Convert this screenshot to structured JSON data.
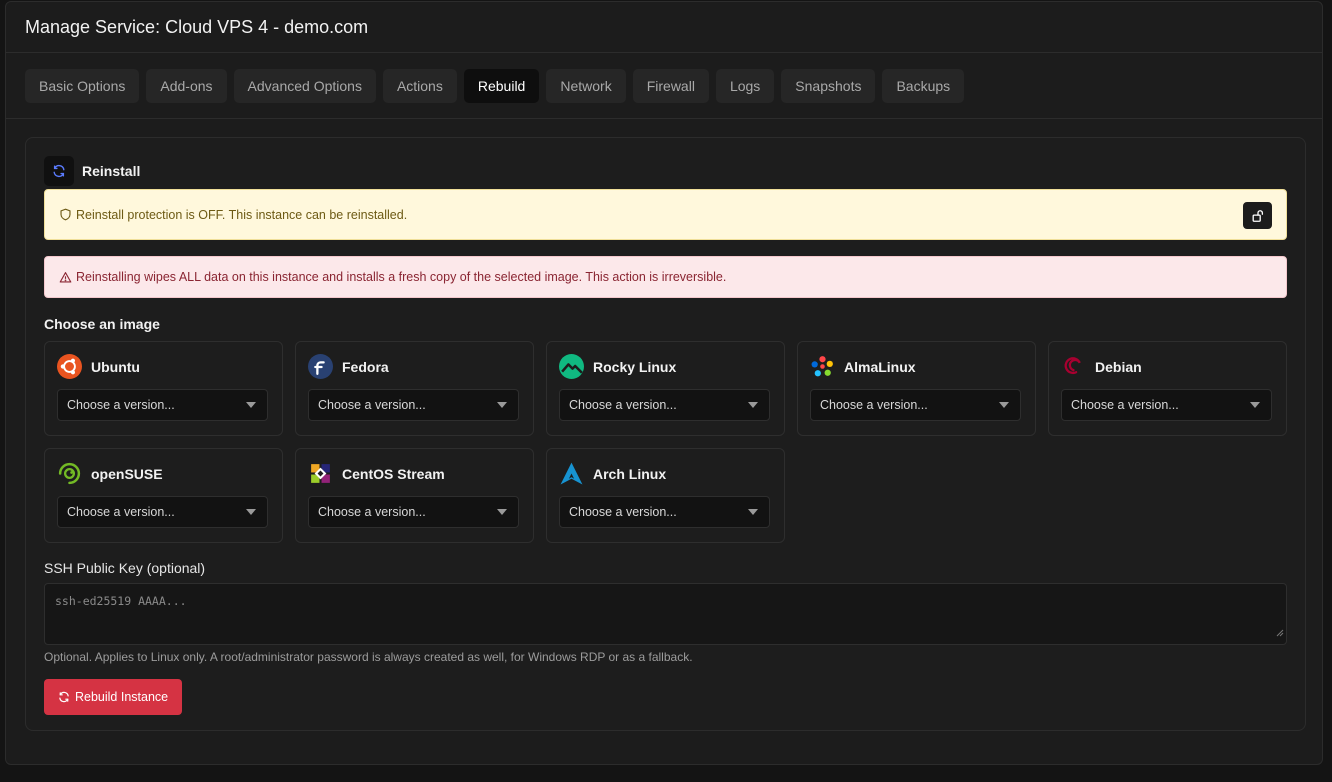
{
  "header": {
    "title": "Manage Service: Cloud VPS 4 - demo.com"
  },
  "tabs": [
    {
      "label": "Basic Options"
    },
    {
      "label": "Add-ons"
    },
    {
      "label": "Advanced Options"
    },
    {
      "label": "Actions"
    },
    {
      "label": "Rebuild",
      "active": true
    },
    {
      "label": "Network"
    },
    {
      "label": "Firewall"
    },
    {
      "label": "Logs"
    },
    {
      "label": "Snapshots"
    },
    {
      "label": "Backups"
    }
  ],
  "reinstall": {
    "title": "Reinstall",
    "protection_alert": "Reinstall protection is OFF. This instance can be reinstalled.",
    "danger_alert": "Reinstalling wipes ALL data on this instance and installs a fresh copy of the selected image. This action is irreversible.",
    "choose_image_label": "Choose an image",
    "images": [
      {
        "name": "Ubuntu",
        "select_value": "Choose a version...",
        "icon": "ubuntu-logo"
      },
      {
        "name": "Fedora",
        "select_value": "Choose a version...",
        "icon": "fedora-logo"
      },
      {
        "name": "Rocky Linux",
        "select_value": "Choose a version...",
        "icon": "rocky-linux-logo"
      },
      {
        "name": "AlmaLinux",
        "select_value": "Choose a version...",
        "icon": "almalinux-logo"
      },
      {
        "name": "Debian",
        "select_value": "Choose a version...",
        "icon": "debian-logo"
      },
      {
        "name": "openSUSE",
        "select_value": "Choose a version...",
        "icon": "opensuse-logo"
      },
      {
        "name": "CentOS Stream",
        "select_value": "Choose a version...",
        "icon": "centos-logo"
      },
      {
        "name": "Arch Linux",
        "select_value": "Choose a version...",
        "icon": "arch-linux-logo"
      }
    ],
    "ssh_label": "SSH Public Key (optional)",
    "ssh_placeholder": "ssh-ed25519 AAAA...",
    "ssh_help": "Optional. Applies to Linux only. A root/administrator password is always created as well, for Windows RDP or as a fallback.",
    "rebuild_button": "Rebuild Instance"
  },
  "colors": {
    "accent_danger": "#d53343",
    "warning_bg": "#fff8dc",
    "danger_bg": "#fce8ea",
    "refresh_icon": "#5b7cff"
  }
}
